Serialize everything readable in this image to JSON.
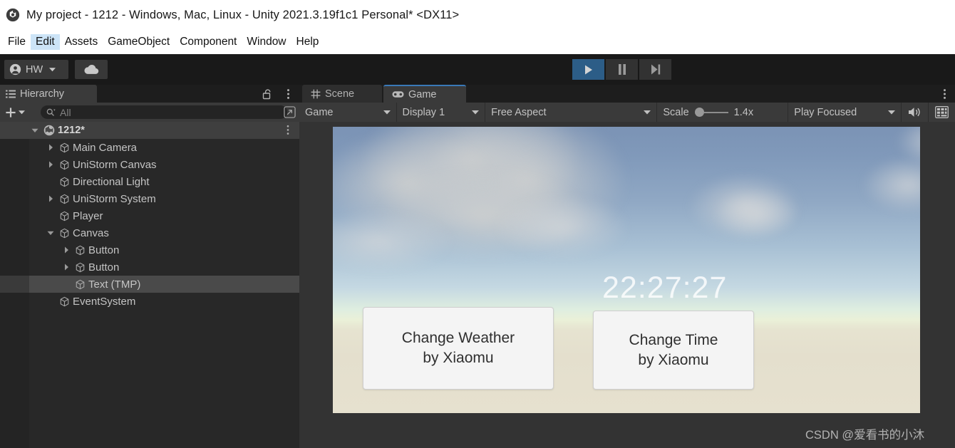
{
  "window": {
    "title": "My project - 1212 - Windows, Mac, Linux - Unity 2021.3.19f1c1 Personal* <DX11>",
    "logo_icon": "unity-logo-icon"
  },
  "menubar": {
    "items": [
      {
        "label": "File",
        "active": false
      },
      {
        "label": "Edit",
        "active": true
      },
      {
        "label": "Assets",
        "active": false
      },
      {
        "label": "GameObject",
        "active": false
      },
      {
        "label": "Component",
        "active": false
      },
      {
        "label": "Window",
        "active": false
      },
      {
        "label": "Help",
        "active": false
      }
    ]
  },
  "toolbar": {
    "account_label": "HW",
    "account_icon": "account-avatar-icon",
    "account_caret_icon": "chevron-down-icon",
    "cloud_icon": "cloud-icon",
    "play_icon": "play-icon",
    "pause_icon": "pause-icon",
    "step_icon": "step-forward-icon",
    "play_active": true,
    "play_active_color": "#2c5d87"
  },
  "hierarchy": {
    "tab_label": "Hierarchy",
    "tab_icon": "hierarchy-list-icon",
    "lock_icon": "lock-open-icon",
    "menu_icon": "kebab-menu-icon",
    "add_icon": "plus-icon",
    "add_caret_icon": "chevron-down-icon",
    "search_icon": "search-icon",
    "search_value": "",
    "search_placeholder": "All",
    "expand_icon": "expand-window-icon",
    "root_menu_icon": "kebab-menu-icon",
    "items": [
      {
        "label": "1212*",
        "depth": 0,
        "arrow": "down",
        "icon": "scene-icon",
        "selected": false,
        "is_root": true
      },
      {
        "label": "Main Camera",
        "depth": 1,
        "arrow": "right",
        "icon": "gameobject-icon",
        "selected": false,
        "is_root": false
      },
      {
        "label": "UniStorm Canvas",
        "depth": 1,
        "arrow": "right",
        "icon": "gameobject-icon",
        "selected": false,
        "is_root": false
      },
      {
        "label": "Directional Light",
        "depth": 1,
        "arrow": "none",
        "icon": "gameobject-icon",
        "selected": false,
        "is_root": false
      },
      {
        "label": "UniStorm System",
        "depth": 1,
        "arrow": "right",
        "icon": "gameobject-icon",
        "selected": false,
        "is_root": false
      },
      {
        "label": "Player",
        "depth": 1,
        "arrow": "none",
        "icon": "gameobject-icon",
        "selected": false,
        "is_root": false
      },
      {
        "label": "Canvas",
        "depth": 1,
        "arrow": "down",
        "icon": "gameobject-icon",
        "selected": false,
        "is_root": false
      },
      {
        "label": "Button",
        "depth": 2,
        "arrow": "right",
        "icon": "gameobject-icon",
        "selected": false,
        "is_root": false
      },
      {
        "label": "Button",
        "depth": 2,
        "arrow": "right",
        "icon": "gameobject-icon",
        "selected": false,
        "is_root": false
      },
      {
        "label": "Text (TMP)",
        "depth": 2,
        "arrow": "none",
        "icon": "gameobject-icon",
        "selected": true,
        "is_root": false
      },
      {
        "label": "EventSystem",
        "depth": 1,
        "arrow": "none",
        "icon": "gameobject-icon",
        "selected": false,
        "is_root": false
      }
    ]
  },
  "game_panel": {
    "tabs": [
      {
        "label": "Scene",
        "icon": "scene-grid-icon",
        "active": false
      },
      {
        "label": "Game",
        "icon": "gamepad-icon",
        "active": true
      }
    ],
    "menu_icon": "kebab-menu-icon",
    "active_tab_accent": "#3a79b8",
    "toolbar": {
      "target_label": "Game",
      "target_caret_icon": "chevron-down-icon",
      "display_label": "Display 1",
      "display_caret_icon": "chevron-down-icon",
      "aspect_label": "Free Aspect",
      "aspect_caret_icon": "chevron-down-icon",
      "scale_label": "Scale",
      "scale_value": "1.4x",
      "scale_percent": 12,
      "play_mode_label": "Play Focused",
      "play_mode_caret_icon": "chevron-down-icon",
      "mute_icon": "speaker-audio-icon",
      "stats_icon": "gizmos-grid-icon"
    },
    "render": {
      "time_display": "22:27:27",
      "buttons": [
        {
          "line1": "Change Weather",
          "line2": "by Xiaomu"
        },
        {
          "line1": "Change Time",
          "line2": "by Xiaomu"
        }
      ],
      "sky_top_color": "#7b93b5",
      "horizon_color": "#eaf0d8",
      "ground_color": "#e4dfcd"
    }
  },
  "watermark": {
    "text": "CSDN @爱看书的小沐"
  }
}
